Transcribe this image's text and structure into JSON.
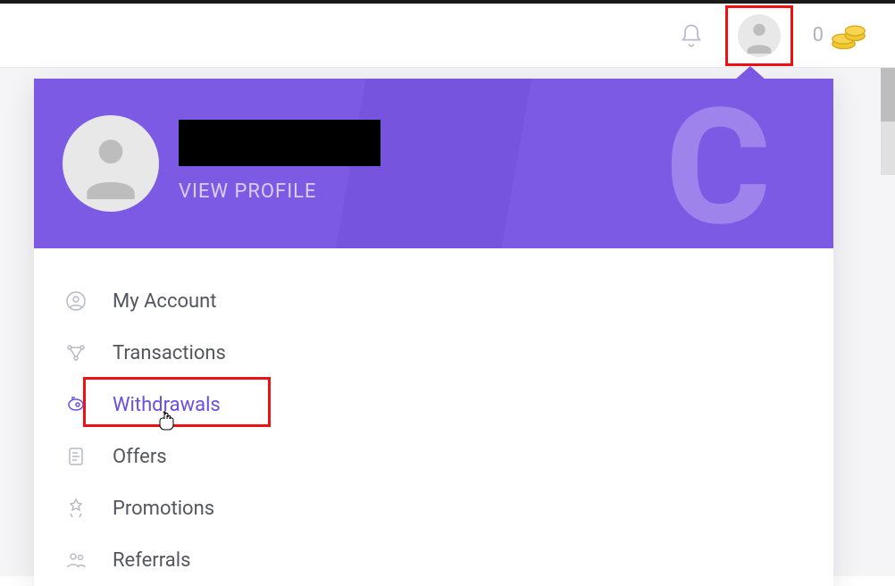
{
  "header": {
    "coin_balance": "0"
  },
  "dropdown": {
    "view_profile_label": "VIEW PROFILE",
    "menu": [
      {
        "label": "My Account"
      },
      {
        "label": "Transactions"
      },
      {
        "label": "Withdrawals"
      },
      {
        "label": "Offers"
      },
      {
        "label": "Promotions"
      },
      {
        "label": "Referrals"
      }
    ]
  }
}
